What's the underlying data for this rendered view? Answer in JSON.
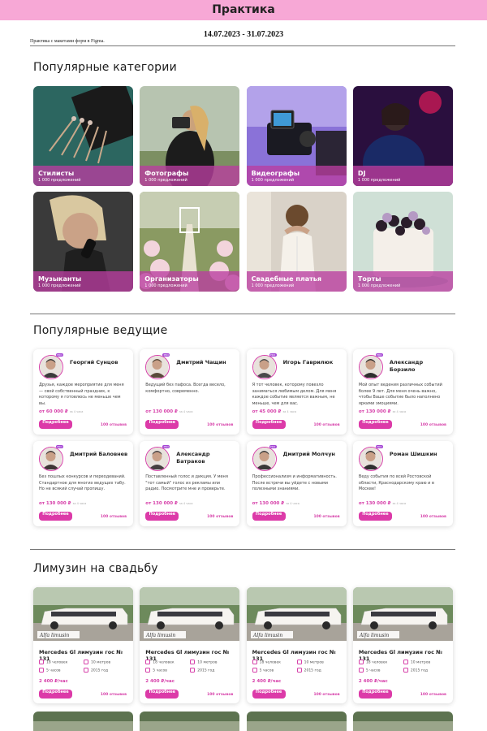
{
  "header": {
    "title": "Практика"
  },
  "date_range": "14.07.2023 - 31.07.2023",
  "note": "Практика с макетами форм в Figma.",
  "categories": {
    "title": "Популярные категории",
    "items": [
      {
        "label": "Стилисты",
        "sub": "1 000 предложений"
      },
      {
        "label": "Фотографы",
        "sub": "1 000 предложений"
      },
      {
        "label": "Видеографы",
        "sub": "1 000 предложений"
      },
      {
        "label": "DJ",
        "sub": "1 000 предложений"
      },
      {
        "label": "Музыканты",
        "sub": "1 000 предложений"
      },
      {
        "label": "Организаторы",
        "sub": "1 000 предложений"
      },
      {
        "label": "Свадебные платья",
        "sub": "1 000 предложений"
      },
      {
        "label": "Торты",
        "sub": "1 000 предложений"
      }
    ]
  },
  "hosts": {
    "title": "Популярные ведущие",
    "button_label": "Подробнее",
    "reviews": "100 отзывов",
    "price_note": "за 4 часа",
    "pro_label": "PRO",
    "items": [
      {
        "name": "Георгий Сунцов",
        "desc": "Друзья, каждое мероприятие для меня — свой собственный праздник, к которому я готовлюсь не меньше чем вы.",
        "price": "от 60 000 ₽"
      },
      {
        "name": "Дмитрий Чащин",
        "desc": "Ведущий без пафоса. Всегда весело, комфортно, современно.",
        "price": "от 130 000 ₽"
      },
      {
        "name": "Игорь Гаврилюк",
        "desc": "Я тот человек, которому повезло заниматься любимым делом. Для меня каждое событие является важным, не меньше, чем для вас.",
        "price": "от 45 000 ₽"
      },
      {
        "name": "Александр Борзило",
        "desc": "Мой опыт ведения различных событий более 9 лет. Для меня очень важно, чтобы Ваше событие было наполнено яркими эмоциями.",
        "price": "от 130 000 ₽"
      },
      {
        "name": "Дмитрий Баловнев",
        "desc": "Без пошлых конкурсов и переодеваний. Стандартное для многих ведущих табу. Но не всякий случай пропишу.",
        "price": "от 130 000 ₽"
      },
      {
        "name": "Александр Батраков",
        "desc": "Поставленный голос и дикция. У меня \"тот самый\" голос из рекламы или радио. Посмотрите мне и проверьте.",
        "price": "от 130 000 ₽"
      },
      {
        "name": "Дмитрий Молчун",
        "desc": "Профессионализм и информативность. После встречи вы уйдете с новыми полезными знаниями.",
        "price": "от 130 000 ₽"
      },
      {
        "name": "Роман Шишкин",
        "desc": "Веду события по всей Ростовской области, Краснодарскому краю и в Москве!",
        "price": "от 130 000 ₽"
      }
    ]
  },
  "limo": {
    "title": "Лимузин на свадьбу",
    "button_label": "Подробнее",
    "reviews": "100 отзывов",
    "watermark": "Alfa limusin",
    "items": [
      {
        "name": "Mercedes Gl лимузин гос № 131",
        "people": "18 человек",
        "length": "10 метров",
        "hours": "5 часов",
        "year": "2015 год",
        "price": "2 400 ₽/час"
      },
      {
        "name": "Mercedes Gl лимузин гос № 131",
        "people": "18 человек",
        "length": "10 метров",
        "hours": "5 часов",
        "year": "2015 год",
        "price": "2 400 ₽/час"
      },
      {
        "name": "Mercedes Gl лимузин гос № 131",
        "people": "18 человек",
        "length": "10 метров",
        "hours": "5 часов",
        "year": "2015 год",
        "price": "2 400 ₽/час"
      },
      {
        "name": "Mercedes Gl лимузин гос № 131",
        "people": "18 человек",
        "length": "10 метров",
        "hours": "5 часов",
        "year": "2015 год",
        "price": "2 400 ₽/час"
      }
    ]
  },
  "colors": {
    "accent": "#dc3aa8",
    "header_bg": "#f7a8d6",
    "overlay": "#ba3ea0"
  }
}
